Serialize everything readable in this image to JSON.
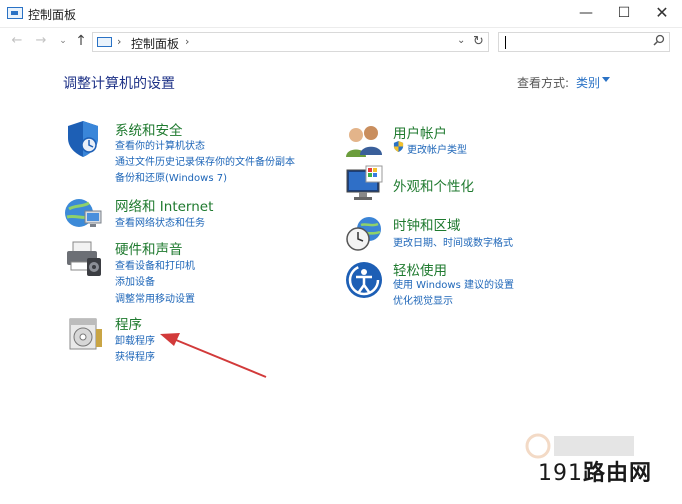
{
  "window": {
    "title": "控制面板",
    "minimize_glyph": "—",
    "maximize_glyph": "☐",
    "close_glyph": "✕"
  },
  "nav": {
    "back_glyph": "←",
    "forward_glyph": "→",
    "recent_glyph": "⌄",
    "up_glyph": "↑",
    "separator": "›",
    "location": "控制面板",
    "dropdown_glyph": "⌄",
    "refresh_glyph": "↻",
    "search_value": "",
    "search_icon": "search-icon"
  },
  "header": {
    "title": "调整计算机的设置",
    "view_by_label": "查看方式:",
    "view_by_value": "类别"
  },
  "left_categories": [
    {
      "title": "系统和安全",
      "icon": "shield-icon",
      "links": [
        "查看你的计算机状态",
        "通过文件历史记录保存你的文件备份副本",
        "备份和还原(Windows 7)"
      ]
    },
    {
      "title": "网络和 Internet",
      "icon": "network-globe-icon",
      "links": [
        "查看网络状态和任务"
      ]
    },
    {
      "title": "硬件和声音",
      "icon": "printer-speaker-icon",
      "links": [
        "查看设备和打印机",
        "添加设备",
        "调整常用移动设置"
      ]
    },
    {
      "title": "程序",
      "icon": "programs-disc-icon",
      "links": [
        "卸载程序",
        "获得程序"
      ]
    }
  ],
  "right_categories": [
    {
      "title": "用户帐户",
      "icon": "users-icon",
      "links": [
        "更改帐户类型"
      ]
    },
    {
      "title": "外观和个性化",
      "icon": "monitor-palette-icon",
      "links": []
    },
    {
      "title": "时钟和区域",
      "icon": "clock-globe-icon",
      "links": [
        "更改日期、时间或数字格式"
      ]
    },
    {
      "title": "轻松使用",
      "icon": "accessibility-icon",
      "links": [
        "使用 Windows 建议的设置",
        "优化视觉显示"
      ]
    }
  ],
  "watermark": {
    "text_num": "191",
    "text_cn": "路由网"
  },
  "colors": {
    "category_title": "#1f7a2f",
    "link": "#1e66b8",
    "page_title": "#1e3287",
    "arrow": "#d23a3a"
  }
}
